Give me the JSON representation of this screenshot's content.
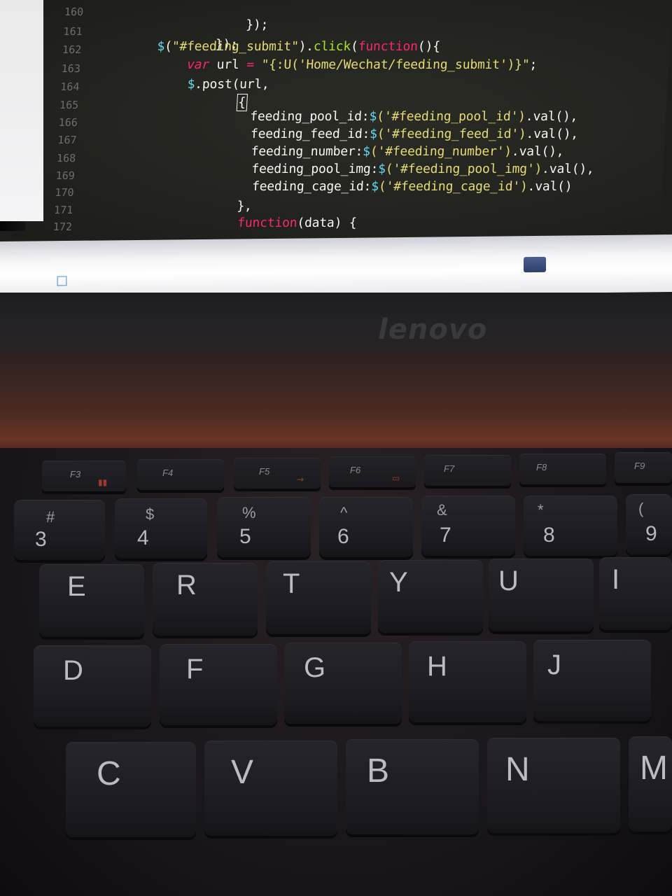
{
  "screen": {
    "line_numbers": [
      "160",
      "161",
      "162",
      "163",
      "164",
      "165",
      "166",
      "167",
      "168",
      "169",
      "170",
      "171",
      "172"
    ],
    "code": {
      "l160": "});",
      "l161": "});",
      "l162_dollar": "$",
      "l162_a": "(",
      "l162_str": "\"#feeding_submit\"",
      "l162_b": ").",
      "l162_click": "click",
      "l162_c": "(",
      "l162_function": "function",
      "l162_d": "(){",
      "l163_var": "var",
      "l163_a": " url ",
      "l163_eq": "=",
      "l163_str": " \"{:U('Home/Wechat/feeding_submit')}\"",
      "l163_b": ";",
      "l164_dollar": "$",
      "l164_a": ".post(url,",
      "l165": "{",
      "l166_key": "feeding_pool_id:",
      "l166_dollar": "$",
      "l166_str": "('#feeding_pool_id')",
      "l166_b": ".val(),",
      "l167_key": "feeding_feed_id:",
      "l167_dollar": "$",
      "l167_str": "('#feeding_feed_id')",
      "l167_b": ".val(),",
      "l168_key": "feeding_number:",
      "l168_dollar": "$",
      "l168_str": "('#feeding_number')",
      "l168_b": ".val(),",
      "l169_key": "feeding_pool_img:",
      "l169_dollar": "$",
      "l169_str": "('#feeding_pool_img')",
      "l169_b": ".val(),",
      "l170_key": "feeding_cage_id:",
      "l170_dollar": "$",
      "l170_str": "('#feeding_cage_id')",
      "l170_b": ".val()",
      "l171": "},",
      "l172_function": "function",
      "l172_a": "(data) {"
    }
  },
  "bezel": {
    "logo": "lenovo"
  },
  "keyboard": {
    "function_row": [
      "F3",
      "F4",
      "F5",
      "F6",
      "F7",
      "F8",
      "F9"
    ],
    "number_row": [
      {
        "shift": "#",
        "digit": "3"
      },
      {
        "shift": "$",
        "digit": "4"
      },
      {
        "shift": "%",
        "digit": "5"
      },
      {
        "shift": "^",
        "digit": "6"
      },
      {
        "shift": "&",
        "digit": "7"
      },
      {
        "shift": "*",
        "digit": "8"
      },
      {
        "shift": "(",
        "digit": "9"
      }
    ],
    "top_letter_row": [
      "E",
      "R",
      "T",
      "Y",
      "U",
      "I"
    ],
    "home_row": [
      "D",
      "F",
      "G",
      "H",
      "J"
    ],
    "bottom_row": [
      "C",
      "V",
      "B",
      "N",
      "M"
    ]
  }
}
